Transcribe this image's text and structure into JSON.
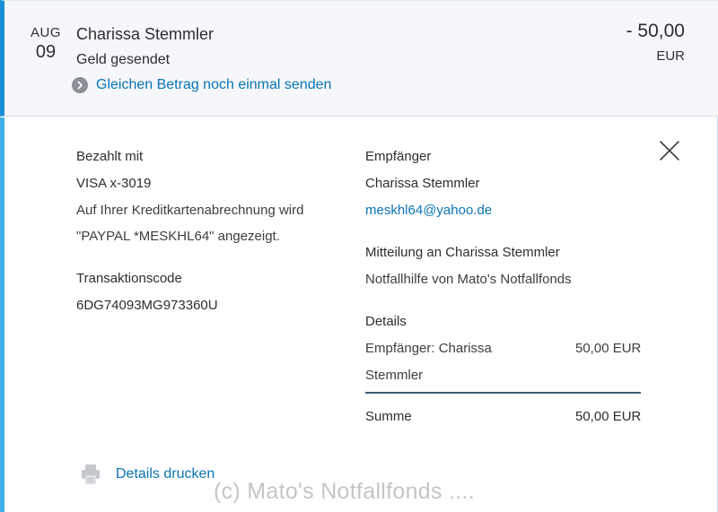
{
  "transaction": {
    "month": "AUG",
    "day": "09",
    "name": "Charissa Stemmler",
    "type": "Geld gesendet",
    "repeat_label": "Gleichen Betrag noch einmal senden",
    "amount": "- 50,00",
    "currency": "EUR",
    "accent_color": "#1a8fd6"
  },
  "left": {
    "paid_with_label": "Bezahlt mit",
    "card": "VISA x-3019",
    "statement_line1": "Auf Ihrer Kreditkartenabrechnung wird",
    "statement_line2": "\"PAYPAL *MESKHL64\" angezeigt.",
    "txn_code_label": "Transaktionscode",
    "txn_code": "6DG74093MG973360U"
  },
  "right": {
    "recipient_label": "Empfänger",
    "recipient_name": "Charissa Stemmler",
    "recipient_email": "meskhl64@yahoo.de",
    "message_label": "Mitteilung an Charissa Stemmler",
    "message": "Notfallhilfe von Mato's Notfallfonds",
    "details_label": "Details",
    "detail_item_line1": "Empfänger: Charissa",
    "detail_item_line2": "Stemmler",
    "detail_item_amount": "50,00 EUR",
    "sum_label": "Summe",
    "sum_amount": "50,00 EUR"
  },
  "actions": {
    "print_label": "Details drucken",
    "close_icon": "close-icon",
    "print_icon": "printer-icon"
  },
  "watermark": "(c) Mato's Notfallfonds ...."
}
